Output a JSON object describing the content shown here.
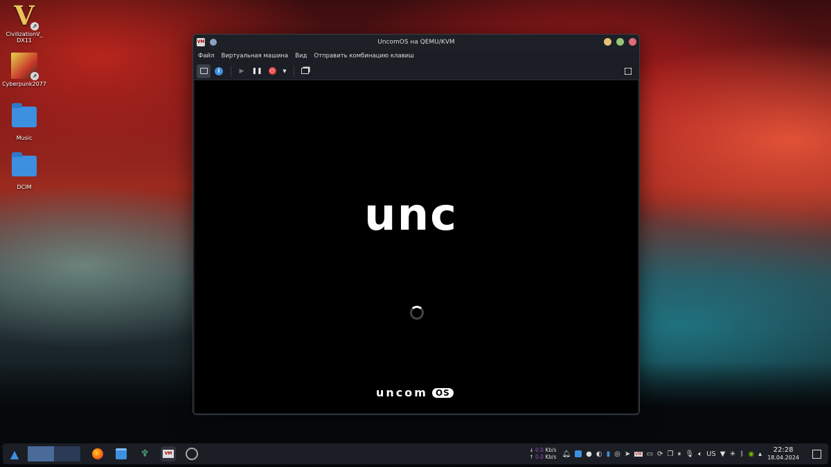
{
  "desktop": {
    "icons": [
      {
        "label": "CivilizationV_ DX11"
      },
      {
        "label": "Cyberpunk2077"
      },
      {
        "label": "Music"
      },
      {
        "label": "DCIM"
      }
    ]
  },
  "window": {
    "title": "UncomOS на QEMU/KVM",
    "menu": [
      "Файл",
      "Виртуальная машина",
      "Вид",
      "Отправить комбинацию клавиш"
    ],
    "guest": {
      "logo_text": "unc",
      "brand_text": "uncom",
      "brand_badge": "OS"
    }
  },
  "taskbar": {
    "net_down": "0.0",
    "net_up": "0.0",
    "net_unit": "Kb/s",
    "keyboard_layout": "US",
    "time": "22:28",
    "date": "18.04.2024"
  },
  "colors": {
    "window_bg": "#1b1e24",
    "close_btn": "#e06c75",
    "max_btn": "#98c379",
    "min_btn": "#e5c07b"
  }
}
